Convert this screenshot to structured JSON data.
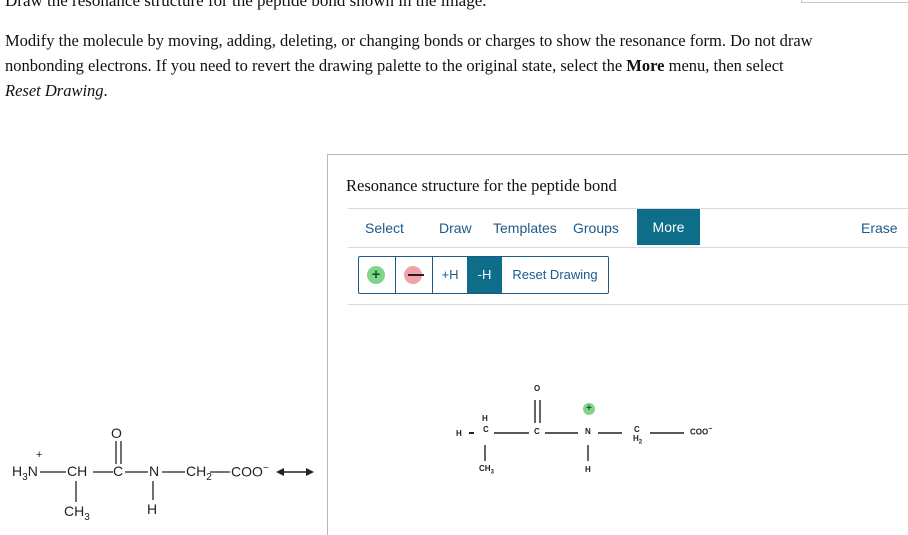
{
  "question": {
    "top_clipped": "Draw the resonance structure for the peptide bond shown in the image.",
    "intro": "Modify the molecule by moving, adding, deleting, or changing bonds or charges to show the resonance form. Do not draw nonbonding electrons. If you need to revert the drawing palette to the original state, select the ",
    "more_word": "More",
    "middle": " menu, then select ",
    "reset_word": "Reset Drawing",
    "end": "."
  },
  "panel": {
    "title": "Resonance structure for the peptide bond",
    "toolbar": {
      "select": "Select",
      "draw": "Draw",
      "templates": "Templates",
      "groups": "Groups",
      "more": "More",
      "erase": "Erase"
    },
    "subtools": {
      "plus_icon": "plus-charge-icon",
      "minus_icon": "minus-charge-icon",
      "add_h": "+H",
      "remove_h": "-H",
      "reset": "Reset Drawing"
    },
    "colors": {
      "accent": "#0e6e8a",
      "link": "#1d5a8a",
      "plus": "#7fd68a",
      "minus": "#f2a3a9"
    }
  },
  "left_molecule": {
    "plus": "+",
    "h3n": "H",
    "h3n_sub": "3",
    "n1": "N",
    "ch": "CH",
    "c": "C",
    "o": "O",
    "n2": "N",
    "ch2": "CH",
    "ch2_sub": "2",
    "coo": "COO",
    "coo_charge": "−",
    "ch3": "CH",
    "ch3_sub": "3",
    "h": "H"
  },
  "canvas_molecule": {
    "h_top": "H",
    "h_left": "H",
    "c1": "C",
    "c2": "C",
    "o": "O",
    "n": "N",
    "plus": "+",
    "c3": "C",
    "h2": "H",
    "h2_sub": "2",
    "coo": "COO",
    "coo_charge": "−",
    "ch3": "CH",
    "ch3_sub": "3",
    "h_bottom": "H"
  }
}
